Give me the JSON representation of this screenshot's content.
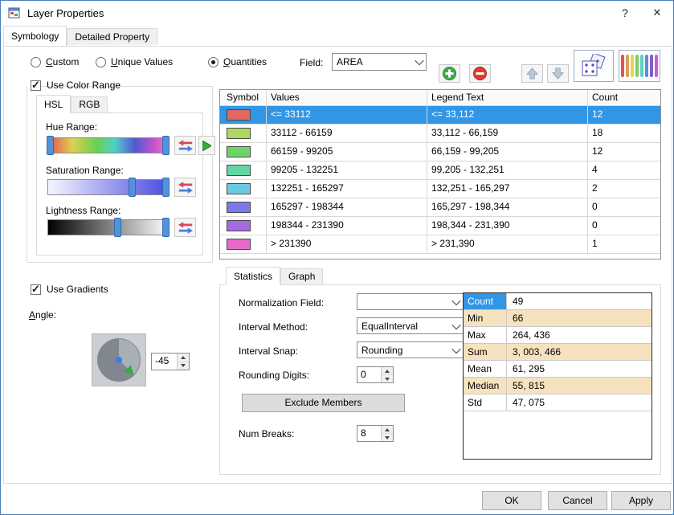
{
  "colors": {
    "selection": "#3296e6",
    "shaded": "#f7e2bf"
  },
  "window": {
    "title": "Layer Properties",
    "help": "?",
    "close": "✕"
  },
  "main_tabs": {
    "symbology": "Symbology",
    "detailed_property": "Detailed Property"
  },
  "classification": {
    "custom": "Custom",
    "unique_values": "Unique Values",
    "quantities": "Quantities",
    "field_label": "Field:",
    "field_value": "AREA"
  },
  "color_range": {
    "checkbox": "Use Color Range",
    "tab_hsl": "HSL",
    "tab_rgb": "RGB",
    "hue": "Hue Range:",
    "saturation": "Saturation Range:",
    "lightness": "Lightness Range:"
  },
  "gradients": {
    "checkbox": "Use Gradients",
    "angle_label": "Angle:",
    "angle_value": "-45"
  },
  "grid": {
    "col_symbol": "Symbol",
    "col_values": "Values",
    "col_legend": "Legend Text",
    "col_count": "Count",
    "rows": [
      {
        "color": "#e0695f",
        "values": "<= 33112",
        "legend": "<= 33,112",
        "count": "12"
      },
      {
        "color": "#aed860",
        "values": "33112 - 66159",
        "legend": "33,112 - 66,159",
        "count": "18"
      },
      {
        "color": "#6fd468",
        "values": "66159 - 99205",
        "legend": "66,159 - 99,205",
        "count": "12"
      },
      {
        "color": "#63d6a4",
        "values": "99205 - 132251",
        "legend": "99,205 - 132,251",
        "count": "4"
      },
      {
        "color": "#69cbe3",
        "values": "132251 - 165297",
        "legend": "132,251 - 165,297",
        "count": "2"
      },
      {
        "color": "#7e79e8",
        "values": "165297 - 198344",
        "legend": "165,297 - 198,344",
        "count": "0"
      },
      {
        "color": "#a569e0",
        "values": "198344 - 231390",
        "legend": "198,344 - 231,390",
        "count": "0"
      },
      {
        "color": "#e668c9",
        "values": "> 231390",
        "legend": "> 231,390",
        "count": "1"
      }
    ]
  },
  "stats": {
    "tab_statistics": "Statistics",
    "tab_graph": "Graph",
    "normalization_label": "Normalization Field:",
    "normalization_value": "",
    "interval_method_label": "Interval Method:",
    "interval_method_value": "EqualInterval",
    "interval_snap_label": "Interval Snap:",
    "interval_snap_value": "Rounding",
    "rounding_digits_label": "Rounding Digits:",
    "rounding_digits_value": "0",
    "exclude_members": "Exclude Members",
    "num_breaks_label": "Num Breaks:",
    "num_breaks_value": "8",
    "rows": [
      {
        "name": "Count",
        "value": "49"
      },
      {
        "name": "Min",
        "value": "66"
      },
      {
        "name": "Max",
        "value": "264, 436"
      },
      {
        "name": "Sum",
        "value": "3, 003, 466"
      },
      {
        "name": "Mean",
        "value": "61, 295"
      },
      {
        "name": "Median",
        "value": "55, 815"
      },
      {
        "name": "Std",
        "value": "47, 075"
      }
    ]
  },
  "footer": {
    "ok": "OK",
    "cancel": "Cancel",
    "apply": "Apply"
  }
}
